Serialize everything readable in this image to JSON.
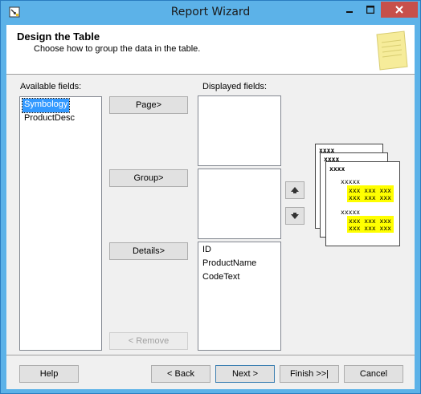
{
  "window": {
    "title": "Report Wizard",
    "colors": {
      "titlebar": "#5cb2e8",
      "close": "#c7504a",
      "selection": "#3399ff",
      "highlight": "#ffff00"
    }
  },
  "header": {
    "title": "Design the Table",
    "subtitle": "Choose how to group the data in the table."
  },
  "available": {
    "label": "Available fields:",
    "items": [
      "Symbology",
      "ProductDesc"
    ]
  },
  "displayed": {
    "label": "Displayed fields:",
    "page_items": [],
    "group_items": [],
    "details_items": [
      "ID",
      "ProductName",
      "CodeText"
    ]
  },
  "buttons": {
    "page": "Page>",
    "group": "Group>",
    "details": "Details>",
    "remove": "< Remove",
    "help": "Help",
    "back": "< Back",
    "next": "Next >",
    "finish": "Finish >>|",
    "cancel": "Cancel"
  },
  "preview": {
    "header_text": "xxxx",
    "group_text": "xxxxx",
    "row_text": "xxx xxx xxx"
  }
}
